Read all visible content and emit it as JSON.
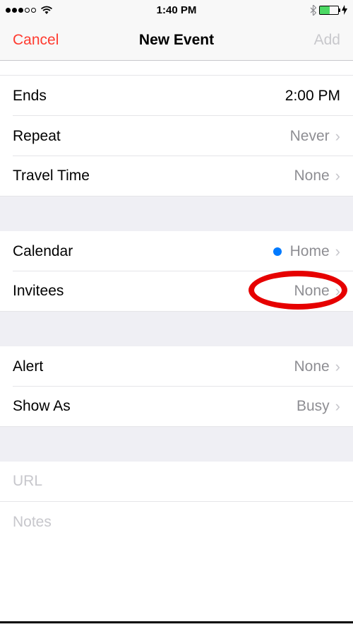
{
  "statusBar": {
    "time": "1:40 PM"
  },
  "nav": {
    "cancel": "Cancel",
    "title": "New Event",
    "add": "Add"
  },
  "rows": {
    "ends": {
      "label": "Ends",
      "value": "2:00 PM"
    },
    "repeat": {
      "label": "Repeat",
      "value": "Never"
    },
    "travelTime": {
      "label": "Travel Time",
      "value": "None"
    },
    "calendar": {
      "label": "Calendar",
      "value": "Home"
    },
    "invitees": {
      "label": "Invitees",
      "value": "None"
    },
    "alert": {
      "label": "Alert",
      "value": "None"
    },
    "showAs": {
      "label": "Show As",
      "value": "Busy"
    },
    "url": {
      "label": "URL"
    },
    "notes": {
      "label": "Notes"
    }
  }
}
